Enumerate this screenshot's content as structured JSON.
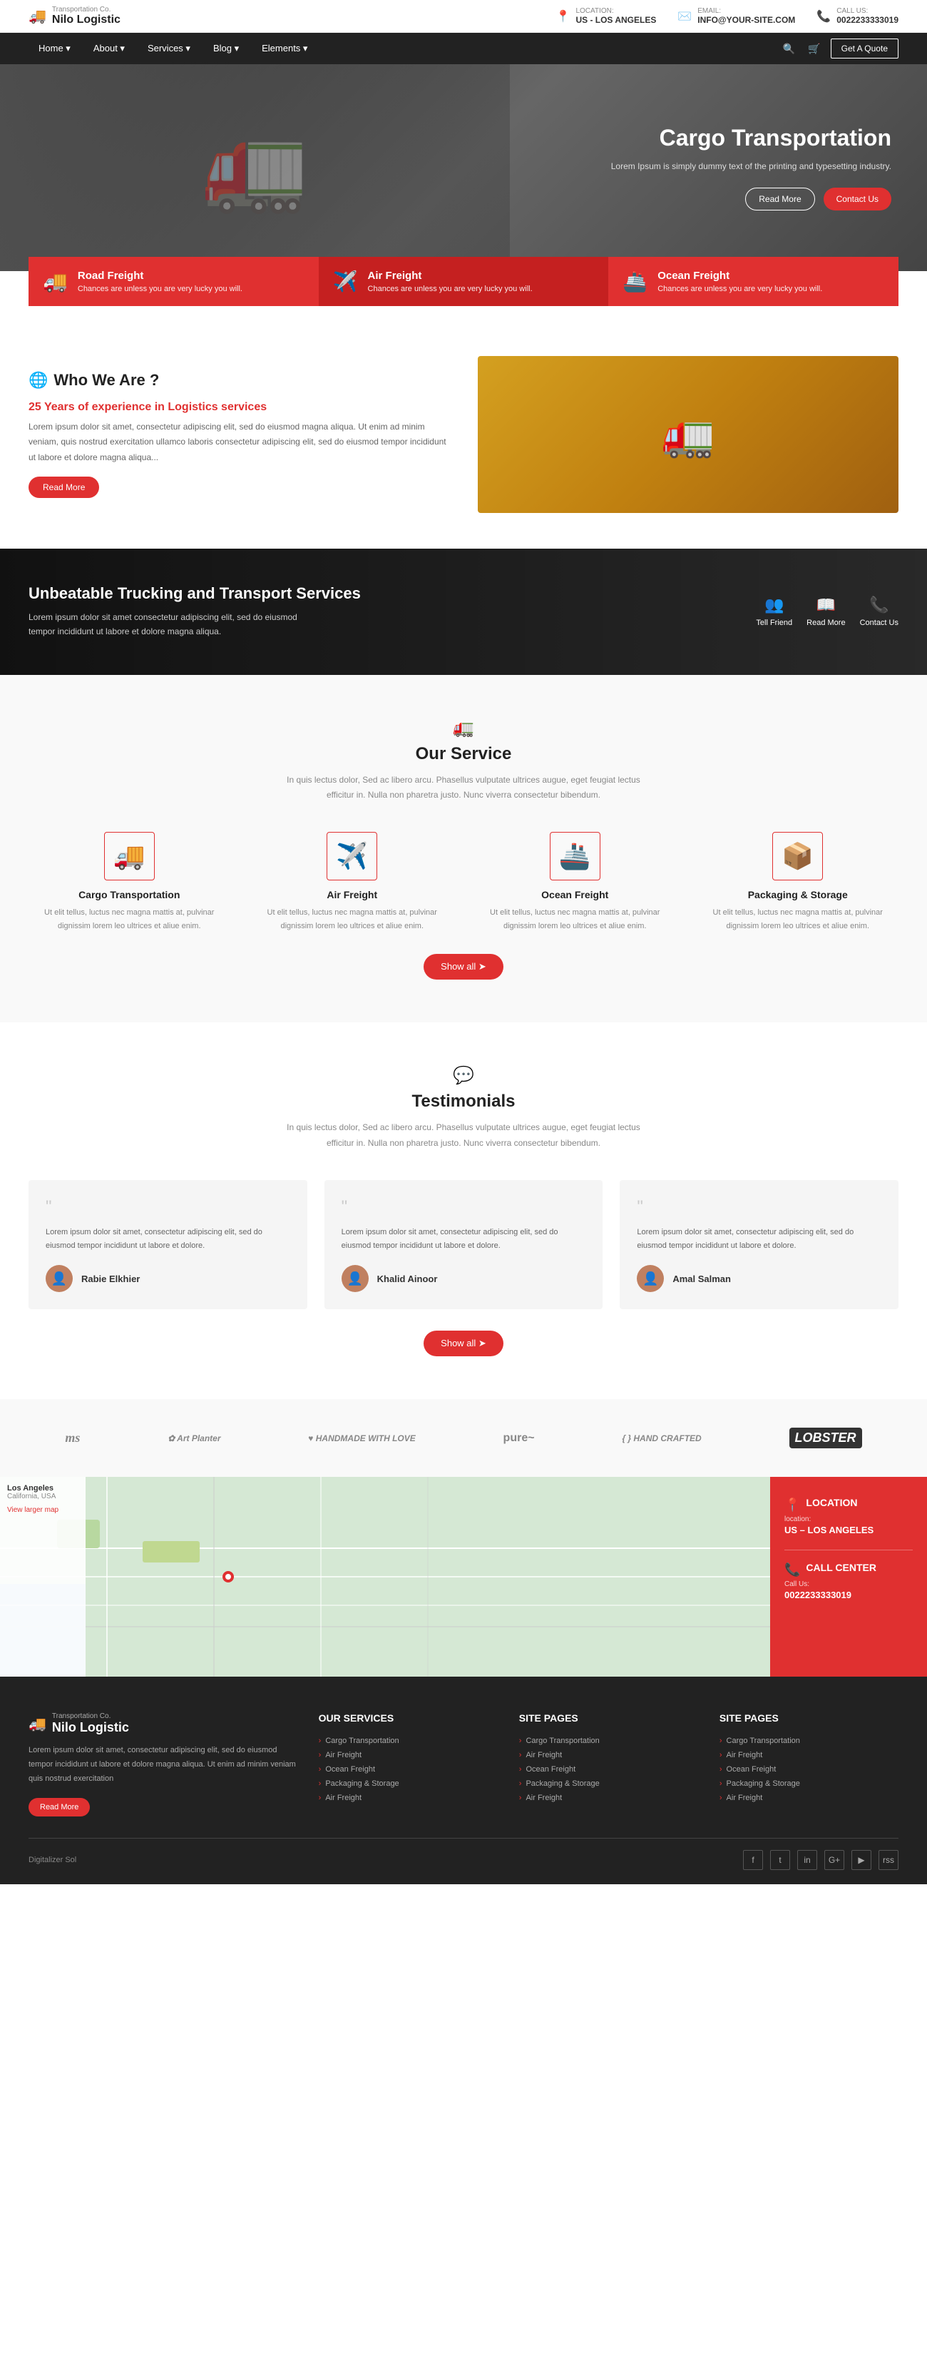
{
  "topbar": {
    "company": "Transportation Co.",
    "brand": "Nilo Logistic",
    "location_label": "Location:",
    "location_value": "US - LOS ANGELES",
    "email_label": "Email:",
    "email_value": "INFO@YOUR-SITE.COM",
    "phone_label": "Call Us:",
    "phone_value": "0022233333019"
  },
  "navbar": {
    "items": [
      "Home",
      "About",
      "Services",
      "Blog",
      "Elements"
    ],
    "search_label": "search",
    "cart_label": "cart",
    "quote_btn": "Get A Quote"
  },
  "hero": {
    "title": "Cargo Transportation",
    "desc": "Lorem Ipsum is simply dummy text of the printing and typesetting industry.",
    "btn_read": "Read More",
    "btn_contact": "Contact Us"
  },
  "service_cards": [
    {
      "icon": "🚚",
      "title": "Road Freight",
      "desc": "Chances are unless you are very lucky you will."
    },
    {
      "icon": "✈️",
      "title": "Air Freight",
      "desc": "Chances are unless you are very lucky you will."
    },
    {
      "icon": "🚢",
      "title": "Ocean Freight",
      "desc": "Chances are unless you are very lucky you will."
    }
  ],
  "who": {
    "icon": "🌐",
    "heading": "Who We Are ?",
    "experience": "25 Years of experience in Logistics services",
    "desc": "Lorem ipsum dolor sit amet, consectetur adipiscing elit, sed do eiusmod magna aliqua. Ut enim ad minim veniam, quis nostrud exercitation ullamco laboris consectetur adipiscing elit, sed do eiusmod tempor incididunt ut labore et dolore magna aliqua...",
    "read_more": "Read More"
  },
  "transport_banner": {
    "title": "Unbeatable Trucking and Transport Services",
    "desc": "Lorem ipsum dolor sit amet consectetur adipiscing elit, sed do eiusmod tempor incididunt ut labore et dolore magna aliqua.",
    "actions": [
      {
        "icon": "👥",
        "label": "Tell Friend"
      },
      {
        "icon": "📖",
        "label": "Read More"
      },
      {
        "icon": "📞",
        "label": "Contact Us"
      }
    ]
  },
  "our_service": {
    "icon": "🚛",
    "heading": "Our Service",
    "desc": "In quis lectus dolor, Sed ac libero arcu. Phasellus vulputate ultrices augue, eget feugiat lectus efficitur in. Nulla non pharetra justo. Nunc viverra consectetur bibendum.",
    "services": [
      {
        "icon": "🚚",
        "title": "Cargo Transportation",
        "desc": "Ut elit tellus, luctus nec magna mattis at, pulvinar dignissim lorem leo ultrices et aliue enim."
      },
      {
        "icon": "✈️",
        "title": "Air Freight",
        "desc": "Ut elit tellus, luctus nec magna mattis at, pulvinar dignissim lorem leo ultrices et aliue enim."
      },
      {
        "icon": "🚢",
        "title": "Ocean Freight",
        "desc": "Ut elit tellus, luctus nec magna mattis at, pulvinar dignissim lorem leo ultrices et aliue enim."
      },
      {
        "icon": "📦",
        "title": "Packaging & Storage",
        "desc": "Ut elit tellus, luctus nec magna mattis at, pulvinar dignissim lorem leo ultrices et aliue enim."
      }
    ],
    "show_all": "Show all"
  },
  "testimonials": {
    "icon": "💬",
    "heading": "Testimonials",
    "desc": "In quis lectus dolor, Sed ac libero arcu. Phasellus vulputate ultrices augue, eget feugiat lectus efficitur in. Nulla non pharetra justo. Nunc viverra consectetur bibendum.",
    "items": [
      {
        "text": "Lorem ipsum dolor sit amet, consectetur adipiscing elit, sed do eiusmod tempor incididunt ut labore et dolore.",
        "name": "Rabie Elkhier",
        "avatar": "👤"
      },
      {
        "text": "Lorem ipsum dolor sit amet, consectetur adipiscing elit, sed do eiusmod tempor incididunt ut labore et dolore.",
        "name": "Khalid Ainoor",
        "avatar": "👤"
      },
      {
        "text": "Lorem ipsum dolor sit amet, consectetur adipiscing elit, sed do eiusmod tempor incididunt ut labore et dolore.",
        "name": "Amal Salman",
        "avatar": "👤"
      }
    ],
    "show_all": "Show all"
  },
  "partners": [
    "ms",
    "Art & Planter",
    "Handmade with Love",
    "pure",
    "Hand Crafted",
    "LOBSTER"
  ],
  "map": {
    "location_heading": "LOCATION",
    "location_label": "location:",
    "location_value": "US – LOS ANGELES",
    "callcenter_heading": "CALL CENTER",
    "callus_label": "Call Us:",
    "callus_value": "0022233333019"
  },
  "footer": {
    "brand": "Nilo Logistic",
    "company": "Transportation Co.",
    "desc": "Lorem ipsum dolor sit amet, consectetur adipiscing elit, sed do eiusmod tempor incididunt ut labore et dolore magna aliqua. Ut enim ad minim veniam quis nostrud exercitation",
    "read_more": "Read More",
    "services_heading": "OUR SERVICES",
    "services": [
      "Cargo Transportation",
      "Air Freight",
      "Ocean Freight",
      "Packaging & Storage",
      "Air Freight"
    ],
    "site_pages_heading1": "SITE PAGES",
    "site_pages1": [
      "Cargo Transportation",
      "Air Freight",
      "Ocean Freight",
      "Packaging & Storage",
      "Air Freight"
    ],
    "site_pages_heading2": "SITE PAGES",
    "site_pages2": [
      "Cargo Transportation",
      "Air Freight",
      "Ocean Freight",
      "Packaging & Storage",
      "Air Freight"
    ],
    "copyright": "Digitalizer Sol",
    "social": [
      "f",
      "t",
      "in",
      "G+",
      "▶",
      "rss"
    ]
  }
}
